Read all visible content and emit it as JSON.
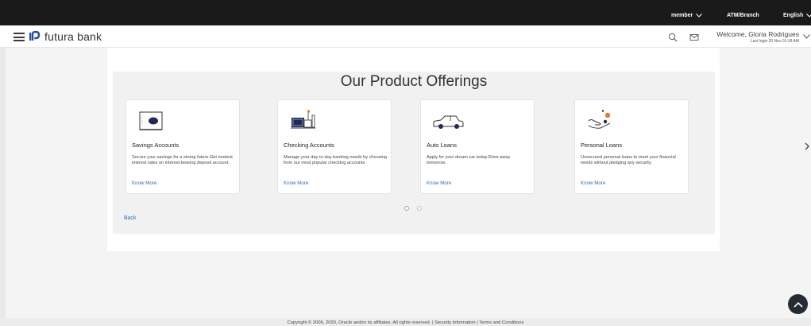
{
  "topbar": {
    "member_label": "member",
    "atm_label": "ATM/Branch",
    "language_label": "English"
  },
  "header": {
    "brand": "futura bank",
    "welcome_text": "Welcome, Gloria Rodrigues",
    "last_login": "Last login 20 Nov 01:09 AM",
    "search_icon": "search-icon",
    "mail_icon": "mail-icon"
  },
  "main": {
    "title": "Our Product Offerings",
    "cards": [
      {
        "icon": "safe-icon",
        "title": "Savings Accounts",
        "description": "Secure your savings for a strong future.Get modest interest rates on interest-bearing deposit account.",
        "link": "Know More"
      },
      {
        "icon": "checkbook-icon",
        "title": "Checking Accounts",
        "description": "Manage your day-to-day banking needs by choosing from our most popular checking accounts",
        "link": "Know More"
      },
      {
        "icon": "car-icon",
        "title": "Auto Loans",
        "description": "Apply for your dream car today.Drive away tomorrow.",
        "link": "Know More"
      },
      {
        "icon": "hand-coin-icon",
        "title": "Personal Loans",
        "description": "Unsecured personal loans to meet your financial needs without pledging any security.",
        "link": "Know More"
      }
    ],
    "carousel_pages": 2,
    "back_label": "Back"
  },
  "footer": {
    "text": "Copyright © 2006, 2020, Oracle and/or its affiliates. All rights reserved. | Security Information | Terms and Conditions"
  },
  "colors": {
    "topbar": "#1a1a1a",
    "link": "#2f6fb3",
    "brand_icon": "#1f4fa0",
    "accent_orange": "#e8792b"
  }
}
